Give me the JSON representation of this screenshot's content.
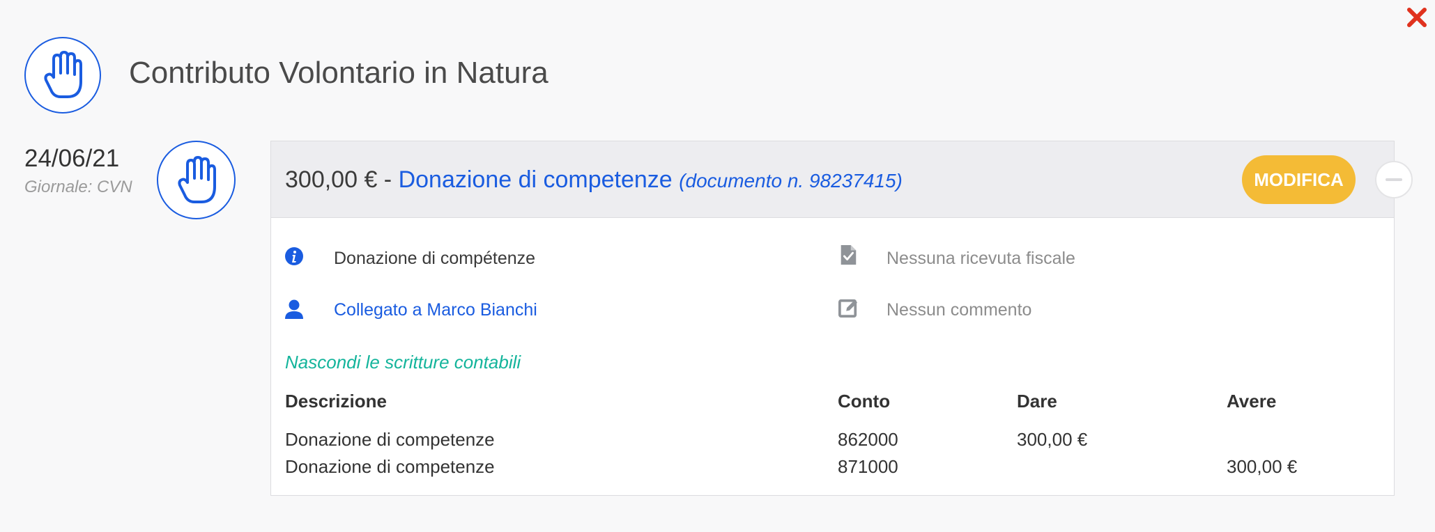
{
  "page": {
    "title": "Contributo Volontario in Natura",
    "close_icon": "close-icon",
    "header_icon": "raised-hand-icon"
  },
  "entry": {
    "date": "24/06/21",
    "journal": "Giornale: CVN",
    "icon": "raised-hand-icon",
    "amount": "300,00 €",
    "separator": " - ",
    "title": "Donazione di competenze",
    "document_ref": "(documento n. 98237415)",
    "edit_label": "MODIFICA",
    "collapse_icon": "minus-circle-icon"
  },
  "details": {
    "description": "Donazione di compétenze",
    "description_icon": "info-icon",
    "linked_contact": "Collegato a Marco Bianchi",
    "linked_icon": "user-icon",
    "receipt": "Nessuna ricevuta fiscale",
    "receipt_icon": "document-check-icon",
    "comment": "Nessun commento",
    "comment_icon": "edit-icon"
  },
  "ledger": {
    "toggle_label": "Nascondi le scritture contabili",
    "headers": {
      "description": "Descrizione",
      "account": "Conto",
      "debit": "Dare",
      "credit": "Avere"
    },
    "rows": [
      {
        "description": "Donazione di competenze",
        "account": "862000",
        "debit": "300,00 €",
        "credit": ""
      },
      {
        "description": "Donazione di competenze",
        "account": "871000",
        "debit": "",
        "credit": "300,00 €"
      }
    ]
  },
  "colors": {
    "accent_blue": "#1a5ce0",
    "button_yellow": "#f4bb36",
    "link_teal": "#13b49b",
    "close_red": "#e0321e"
  }
}
